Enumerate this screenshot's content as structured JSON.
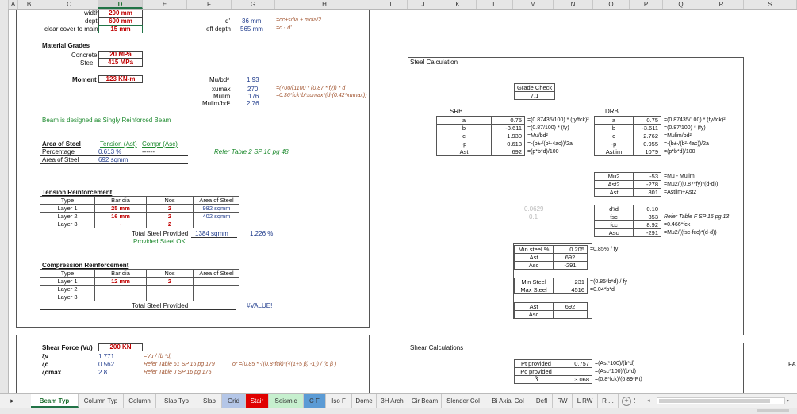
{
  "columns": [
    "A",
    "B",
    "C",
    "D",
    "E",
    "F",
    "G",
    "H",
    "I",
    "J",
    "K",
    "L",
    "M",
    "N",
    "O",
    "P",
    "Q",
    "R",
    "S"
  ],
  "selected_column": "D",
  "inputs": {
    "width_label": "width",
    "width": "200 mm",
    "depth_label": "depth",
    "depth": "600 mm",
    "cover_label": "clear cover to main",
    "cover": "15 mm",
    "dprime_label": "d'",
    "dprime": "36 mm",
    "dprime_f": "=cc+sdia + mdia/2",
    "effd_label": "eff depth",
    "effd": "565 mm",
    "effd_f": "=d - d'"
  },
  "grades": {
    "title": "Material Grades",
    "concrete_label": "Concrete",
    "concrete": "20 MPa",
    "steel_label": "Steel",
    "steel": "415 MPa"
  },
  "moment": {
    "label": "Moment",
    "value": "123 KN-m"
  },
  "calc": {
    "mubd_label": "Mu/bd²",
    "mubd": "1.93",
    "xumax_label": "xumax",
    "xumax": "270",
    "xumax_f": "=(700/(1100 * (0.87 * fy)) * d",
    "mulim_label": "Mulim",
    "mulim": "176",
    "mulim_f": "=0.36*fck*b*xumax*(d-(0.42*xumax))",
    "mulimbd_label": "Mulim/bd²",
    "mulimbd": "2.76"
  },
  "design_msg": "Beam is designed as Singly Reinforced Beam",
  "area": {
    "title": "Area of Steel",
    "tension": "Tension (Ast)",
    "compr": "Compr (Asc)",
    "pct_label": "Percentage",
    "pct": "0.613 %",
    "pct_c": "------",
    "aos_label": "Area of Steel",
    "aos": "692 sqmm",
    "ref": "Refer Table 2 SP 16 pg 48"
  },
  "tension": {
    "title": "Tension Reinforcement",
    "headers": [
      "Type",
      "Bar dia",
      "Nos",
      "Area of Steel"
    ],
    "rows": [
      [
        "Layer 1",
        "25 mm",
        "2",
        "982 sqmm"
      ],
      [
        "Layer 2",
        "16 mm",
        "2",
        "402 sqmm"
      ],
      [
        "Layer 3",
        "-",
        "2",
        ""
      ]
    ],
    "total_label": "Total Steel Provided",
    "total": "1384 sqmm",
    "total_pct": "1.226 %",
    "ok": "Provided Steel OK"
  },
  "compression": {
    "title": "Compression Reinforcement",
    "headers": [
      "Type",
      "Bar dia",
      "Nos",
      "Area of Steel"
    ],
    "rows": [
      [
        "Layer 1",
        "12 mm",
        "2",
        ""
      ],
      [
        "Layer 2",
        "-",
        "",
        ""
      ],
      [
        "Layer 3",
        "",
        ""
      ]
    ],
    "total_label": "Total Steel Provided",
    "total": "#VALUE!"
  },
  "shear": {
    "force_label": "Shear Force (Vu)",
    "force": "200 KN",
    "tv_label": "ζv",
    "tv": "1.771",
    "tv_f": "=Vu / (b *d)",
    "tc_label": "ζc",
    "tc": "0.562",
    "tc_f": "Refer Table 61 SP 16 pg 179",
    "tc_f2": "or  =(0.85 * √(0.8*fck)*(√(1+5 β) -1)) / (6 β )",
    "tcmax_label": "ζcmax",
    "tcmax": "2.8",
    "tcmax_f": "Refer Table J SP 16 pg 175"
  },
  "steel_calc": {
    "title": "Steel Calculation",
    "grade_check": "Grade Check",
    "grade_val": "7.1",
    "srb": "SRB",
    "drb": "DRB",
    "srb_rows": [
      [
        "a",
        "0.75",
        "=(0.87435/100) * (fy/fck)²"
      ],
      [
        "b",
        "-3.611",
        "=(0.87/100) * (fy)"
      ],
      [
        "c",
        "1.930",
        "=Mu/bd²"
      ],
      [
        "-p",
        "0.613",
        "=-(b±√(b²-4ac))/2a"
      ],
      [
        "Ast",
        "692",
        "=(p*b*d)/100"
      ]
    ],
    "drb_rows": [
      [
        "a",
        "0.75",
        "=(0.87435/100) * (fy/fck)²"
      ],
      [
        "b",
        "-3.611",
        "=(0.87/100) * (fy)"
      ],
      [
        "c",
        "2.762",
        "=Mulim/bd²"
      ],
      [
        "-p",
        "0.955",
        "=-(b±√(b²-4ac))/2a"
      ],
      [
        "Astlim",
        "1079",
        "=(p*b*d)/100"
      ]
    ],
    "mu_rows": [
      [
        "Mu2",
        "-53",
        "=Mu - Mulim"
      ],
      [
        "Ast2",
        "-278",
        "=Mu2/((0.87*fy)*(d-d))"
      ],
      [
        "Ast",
        "801",
        "=Astlim+Ast2"
      ]
    ],
    "faint1": "0.0629",
    "faint2": "0.1",
    "fsc_rows": [
      [
        "d'/d",
        "0.10",
        ""
      ],
      [
        "fsc",
        "353",
        "Refer Table F SP 16 pg 13"
      ],
      [
        "fcc",
        "8.92",
        "=0.466*fck"
      ],
      [
        "Asc",
        "-291",
        "=Mu2/((fsc-fcc)*(d-d))"
      ]
    ],
    "min_rows": [
      [
        "Min steel %",
        "0.205",
        "=0.85% / fy"
      ],
      [
        "Ast",
        "692",
        ""
      ],
      [
        "Asc",
        "-291",
        ""
      ]
    ],
    "minmax_rows": [
      [
        "Min Steel",
        "231",
        "=(0.85*b*d) / fy"
      ],
      [
        "Max Steel",
        "4516",
        "=0.04*b*d"
      ]
    ],
    "astasc_rows": [
      [
        "Ast",
        "692"
      ],
      [
        "Asc",
        ""
      ]
    ]
  },
  "shear_calc": {
    "title": "Shear Calculations",
    "rows": [
      [
        "Pt provided",
        "0.757",
        "=(Ast*100)/(b*d)"
      ],
      [
        "Pc provided",
        "",
        "=(Asc*100)/(b*d)"
      ],
      [
        "β",
        "3.068",
        "=(0.8*fck)/(6.89*Pt)"
      ]
    ],
    "fa": "FA"
  },
  "tabs": [
    {
      "label": "Beam Typ",
      "color": ""
    },
    {
      "label": "Column Typ",
      "color": ""
    },
    {
      "label": "Column",
      "color": ""
    },
    {
      "label": "Slab Typ",
      "color": ""
    },
    {
      "label": "Slab",
      "color": ""
    },
    {
      "label": "Grid",
      "color": "#b4c6e7"
    },
    {
      "label": "Stair",
      "color": "#e00000"
    },
    {
      "label": "Seismic",
      "color": "#c6efce"
    },
    {
      "label": "C F",
      "color": "#5b9bd5"
    },
    {
      "label": "Iso F",
      "color": ""
    },
    {
      "label": "Dome",
      "color": ""
    },
    {
      "label": "3H Arch",
      "color": ""
    },
    {
      "label": "Cir Beam",
      "color": ""
    },
    {
      "label": "Slender Col",
      "color": ""
    },
    {
      "label": "Bi Axial Col",
      "color": ""
    },
    {
      "label": "Defl",
      "color": ""
    },
    {
      "label": "RW",
      "color": ""
    },
    {
      "label": "L RW",
      "color": ""
    },
    {
      "label": "R ...",
      "color": ""
    }
  ],
  "active_tab": "Beam Typ"
}
